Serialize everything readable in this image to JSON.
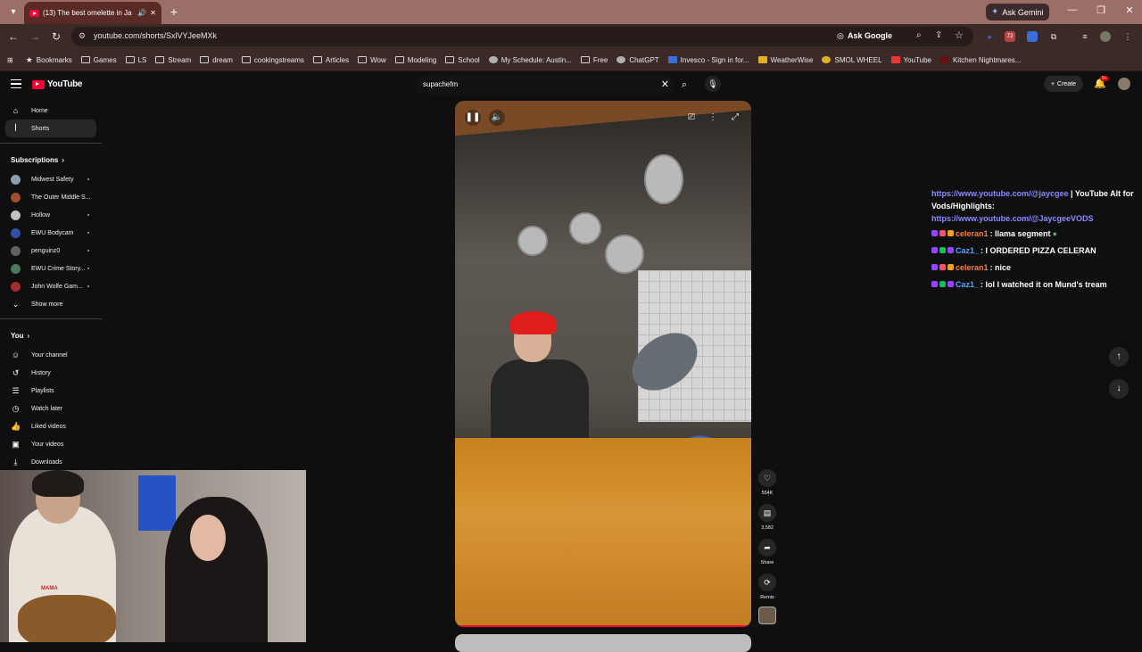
{
  "browser": {
    "tab": {
      "title": "(13) The best omelette in Ja"
    },
    "url": "youtube.com/shorts/SxlVYJeeMXk",
    "ask_google": "Ask Google",
    "gemini": "Ask Gemini",
    "bookmarks": [
      {
        "label": "Bookmarks",
        "icon": "star-icon"
      },
      {
        "label": "Games",
        "icon": "folder-icon"
      },
      {
        "label": "LS",
        "icon": "folder-icon"
      },
      {
        "label": "Stream",
        "icon": "folder-icon"
      },
      {
        "label": "dream",
        "icon": "folder-icon"
      },
      {
        "label": "cookingstreams",
        "icon": "folder-icon"
      },
      {
        "label": "Articles",
        "icon": "folder-icon"
      },
      {
        "label": "Wow",
        "icon": "folder-icon"
      },
      {
        "label": "Modeling",
        "icon": "folder-icon"
      },
      {
        "label": "School",
        "icon": "folder-icon"
      },
      {
        "label": "My Schedule: Austin...",
        "icon": "globe-icon"
      },
      {
        "label": "Free",
        "icon": "folder-icon"
      },
      {
        "label": "ChatGPT",
        "icon": "chatgpt-icon"
      },
      {
        "label": "Invesco - Sign in for...",
        "icon": "invesco-icon"
      },
      {
        "label": "WeatherWise",
        "icon": "weather-icon"
      },
      {
        "label": "SMOL WHEEL",
        "icon": "wheel-icon"
      },
      {
        "label": "YouTube",
        "icon": "youtube-icon"
      },
      {
        "label": "Kitchen Nightmares...",
        "icon": "kitchen-icon"
      }
    ]
  },
  "youtube": {
    "logo_text": "YouTube",
    "search_value": "supachefm",
    "create_label": "Create",
    "notif_count": "9+",
    "sidebar": {
      "main": [
        {
          "label": "Home",
          "icon": "home-icon"
        },
        {
          "label": "Shorts",
          "icon": "shorts-icon"
        }
      ],
      "subscriptions_header": "Subscriptions",
      "subscriptions": [
        {
          "label": "Midwest Safety",
          "color": "#8aa0b0"
        },
        {
          "label": "The Outer Middle S...",
          "color": "#a05030"
        },
        {
          "label": "Hollow",
          "color": "#c0c0c0"
        },
        {
          "label": "EWU Bodycam",
          "color": "#3050a0"
        },
        {
          "label": "penguinz0",
          "color": "#606060"
        },
        {
          "label": "EWU Crime Story...",
          "color": "#4a7a5a"
        },
        {
          "label": "John Wolfe Gam...",
          "color": "#a03030"
        }
      ],
      "show_more": "Show more",
      "you_header": "You",
      "you": [
        {
          "label": "Your channel",
          "icon": "channel-icon"
        },
        {
          "label": "History",
          "icon": "history-icon"
        },
        {
          "label": "Playlists",
          "icon": "playlists-icon"
        },
        {
          "label": "Watch later",
          "icon": "watch-later-icon"
        },
        {
          "label": "Liked videos",
          "icon": "like-icon"
        },
        {
          "label": "Your videos",
          "icon": "your-videos-icon"
        },
        {
          "label": "Downloads",
          "icon": "download-icon"
        }
      ]
    },
    "short": {
      "likes": "554K",
      "comments": "3,582",
      "share": "Share",
      "remix": "Remix",
      "progress": 0.99
    }
  },
  "chat": {
    "link1": "https://www.youtube.com/@jaycgee",
    "text_tail": " | YouTube Alt for Vods/Highlights:",
    "link2": "https://www.youtube.com/@JaycgeeVODS",
    "messages": [
      {
        "name": "celeran1",
        "text": " : llama segment",
        "name_color": "#ff7a3d"
      },
      {
        "name": "Caz1_",
        "text": " : I ORDERED PIZZA CELERAN",
        "name_color": "#4da6ff"
      },
      {
        "name": "celeran1",
        "text": " : nice",
        "name_color": "#ff7a3d"
      },
      {
        "name": "Caz1_",
        "text": " : lol I watched it on Mund's tream",
        "name_color": "#4da6ff"
      }
    ]
  },
  "webcam": {
    "shirt_text": "MAMA"
  },
  "colors": {
    "accent": "#ff0033",
    "tab_strip": "#9b6e68",
    "toolbar": "#3c2a28",
    "page_bg": "#0f0f0f"
  }
}
